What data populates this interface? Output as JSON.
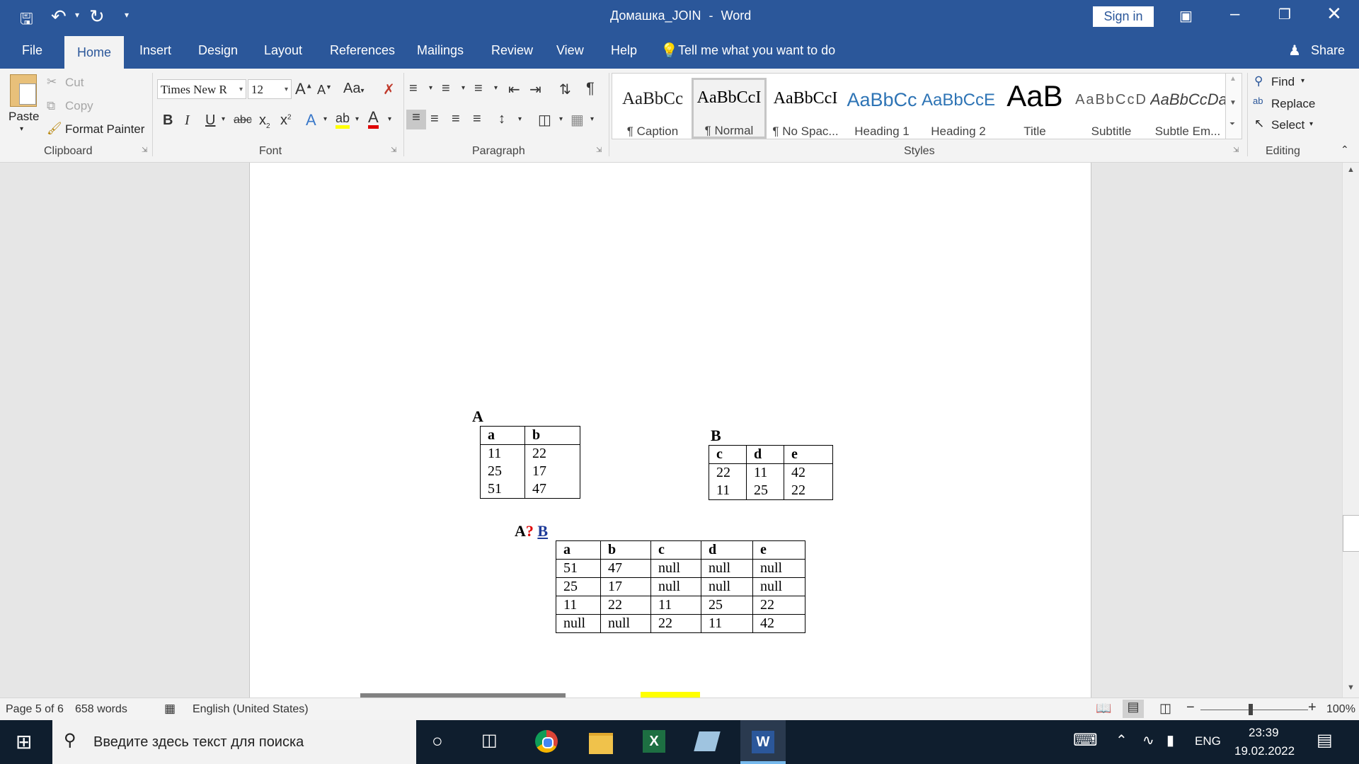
{
  "titlebar": {
    "doc_title": "Домашка_JOIN",
    "separator": "-",
    "app_name": "Word",
    "sign_in": "Sign in"
  },
  "tabs": [
    "File",
    "Home",
    "Insert",
    "Design",
    "Layout",
    "References",
    "Mailings",
    "Review",
    "View",
    "Help"
  ],
  "tell_me": "Tell me what you want to do",
  "share": "Share",
  "clipboard": {
    "paste": "Paste",
    "cut": "Cut",
    "copy": "Copy",
    "format_painter": "Format Painter",
    "group": "Clipboard"
  },
  "font": {
    "name": "Times New R",
    "size": "12",
    "change_case": "Aa",
    "group": "Font"
  },
  "paragraph": {
    "group": "Paragraph"
  },
  "styles": {
    "group": "Styles",
    "items": [
      {
        "sample": "AaBbCc",
        "name": "¶ Caption"
      },
      {
        "sample": "AaBbCcI",
        "name": "¶ Normal"
      },
      {
        "sample": "AaBbCcI",
        "name": "¶ No Spac..."
      },
      {
        "sample": "AaBbCc",
        "name": "Heading 1"
      },
      {
        "sample": "AaBbCcE",
        "name": "Heading 2"
      },
      {
        "sample": "AaB",
        "name": "Title"
      },
      {
        "sample": "AaBbCcD",
        "name": "Subtitle"
      },
      {
        "sample": "AaBbCcDa",
        "name": "Subtle Em..."
      }
    ]
  },
  "editing": {
    "find": "Find",
    "replace": "Replace",
    "select": "Select",
    "group": "Editing"
  },
  "document": {
    "table_a": {
      "label": "A",
      "headers": [
        "a",
        "b"
      ],
      "rows": [
        [
          "11",
          "22"
        ],
        [
          "25",
          "17"
        ],
        [
          "51",
          "47"
        ]
      ]
    },
    "table_b": {
      "label": "B",
      "headers": [
        "c",
        "d",
        "e"
      ],
      "rows": [
        [
          "22",
          "11",
          "42"
        ],
        [
          "11",
          "25",
          "22"
        ]
      ]
    },
    "join_label": {
      "left": "A",
      "op": "?",
      "right": "B"
    },
    "result": {
      "headers": [
        "a",
        "b",
        "c",
        "d",
        "e"
      ],
      "rows": [
        [
          "51",
          "47",
          "null",
          "null",
          "null"
        ],
        [
          "25",
          "17",
          "null",
          "null",
          "null"
        ],
        [
          "11",
          "22",
          "11",
          "25",
          "22"
        ],
        [
          "null",
          "null",
          "22",
          "11",
          "42"
        ]
      ]
    }
  },
  "status": {
    "page": "Page 5 of 6",
    "words": "658 words",
    "language": "English (United States)",
    "zoom": "100%"
  },
  "taskbar": {
    "search_placeholder": "Введите здесь текст для поиска",
    "lang": "ENG",
    "time": "23:39",
    "date": "19.02.2022"
  },
  "colors": {
    "title_blue": "#2b579a",
    "ribbon_bg": "#f3f3f3",
    "highlight_yellow": "#ffff00",
    "font_red": "#e00000",
    "join_q_red": "#e00000",
    "join_b_blue": "#1f3c99"
  }
}
